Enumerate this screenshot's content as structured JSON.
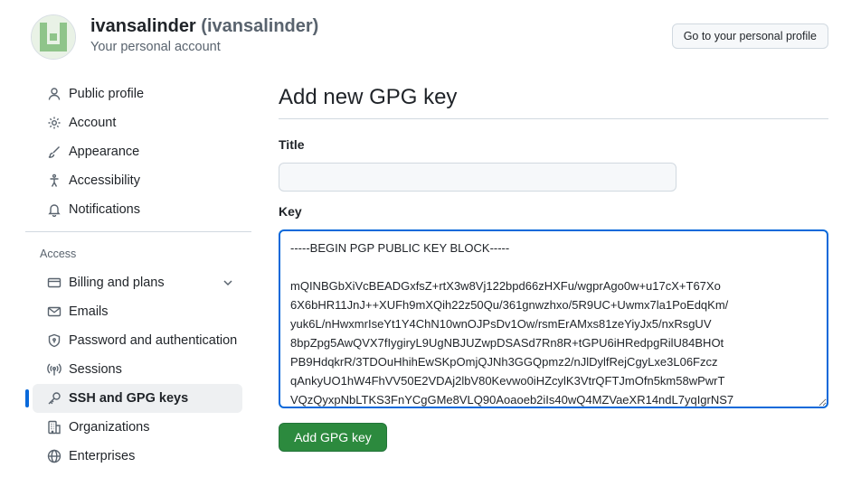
{
  "header": {
    "name": "ivansalinder",
    "login": "(ivansalinder)",
    "subtitle": "Your personal account",
    "profile_button": "Go to your personal profile"
  },
  "sidebar": {
    "items": [
      {
        "label": "Public profile",
        "icon": "person-icon"
      },
      {
        "label": "Account",
        "icon": "gear-icon"
      },
      {
        "label": "Appearance",
        "icon": "paintbrush-icon"
      },
      {
        "label": "Accessibility",
        "icon": "accessibility-icon"
      },
      {
        "label": "Notifications",
        "icon": "bell-icon"
      }
    ],
    "access_label": "Access",
    "access_items": [
      {
        "label": "Billing and plans",
        "icon": "credit-card-icon",
        "expandable": true
      },
      {
        "label": "Emails",
        "icon": "mail-icon"
      },
      {
        "label": "Password and authentication",
        "icon": "shield-lock-icon"
      },
      {
        "label": "Sessions",
        "icon": "broadcast-icon"
      },
      {
        "label": "SSH and GPG keys",
        "icon": "key-icon",
        "active": true
      },
      {
        "label": "Organizations",
        "icon": "organization-icon"
      },
      {
        "label": "Enterprises",
        "icon": "globe-icon"
      }
    ]
  },
  "main": {
    "title": "Add new GPG key",
    "title_field_label": "Title",
    "title_field_value": "",
    "key_field_label": "Key",
    "key_value": "-----BEGIN PGP PUBLIC KEY BLOCK-----\n\nmQINBGbXiVcBEADGxfsZ+rtX3w8Vj122bpd66zHXFu/wgprAgo0w+u17cX+T67Xo\n6X6bHR11JnJ++XUFh9mXQih22z50Qu/361gnwzhxo/5R9UC+Uwmx7la1PoEdqKm/\nyuk6L/nHwxmrIseYt1Y4ChN10wnOJPsDv1Ow/rsmErAMxs81zeYiyJx5/nxRsgUV\n8bpZpg5AwQVX7fIygiryL9UgNBJUZwpDSASd7Rn8R+tGPU6iHRedpgRilU84BHOt\nPB9HdqkrR/3TDOuHhihEwSKpOmjQJNh3GGQpmz2/nJlDylfRejCgyLxe3L06Fzcz\nqAnkyUO1hW4FhVV50E2VDAj2lbV80Kevwo0iHZcylK3VtrQFTJmOfn5km58wPwrT\nVQzQyxpNbLTKS3FnYCgGMe8VLQ90Aoaoeb2iIs40wQ4MZVaeXR14ndL7yqIgrNS7",
    "submit_label": "Add GPG key"
  },
  "colors": {
    "accent": "#0969da",
    "primary_button": "#2c8a3e"
  }
}
